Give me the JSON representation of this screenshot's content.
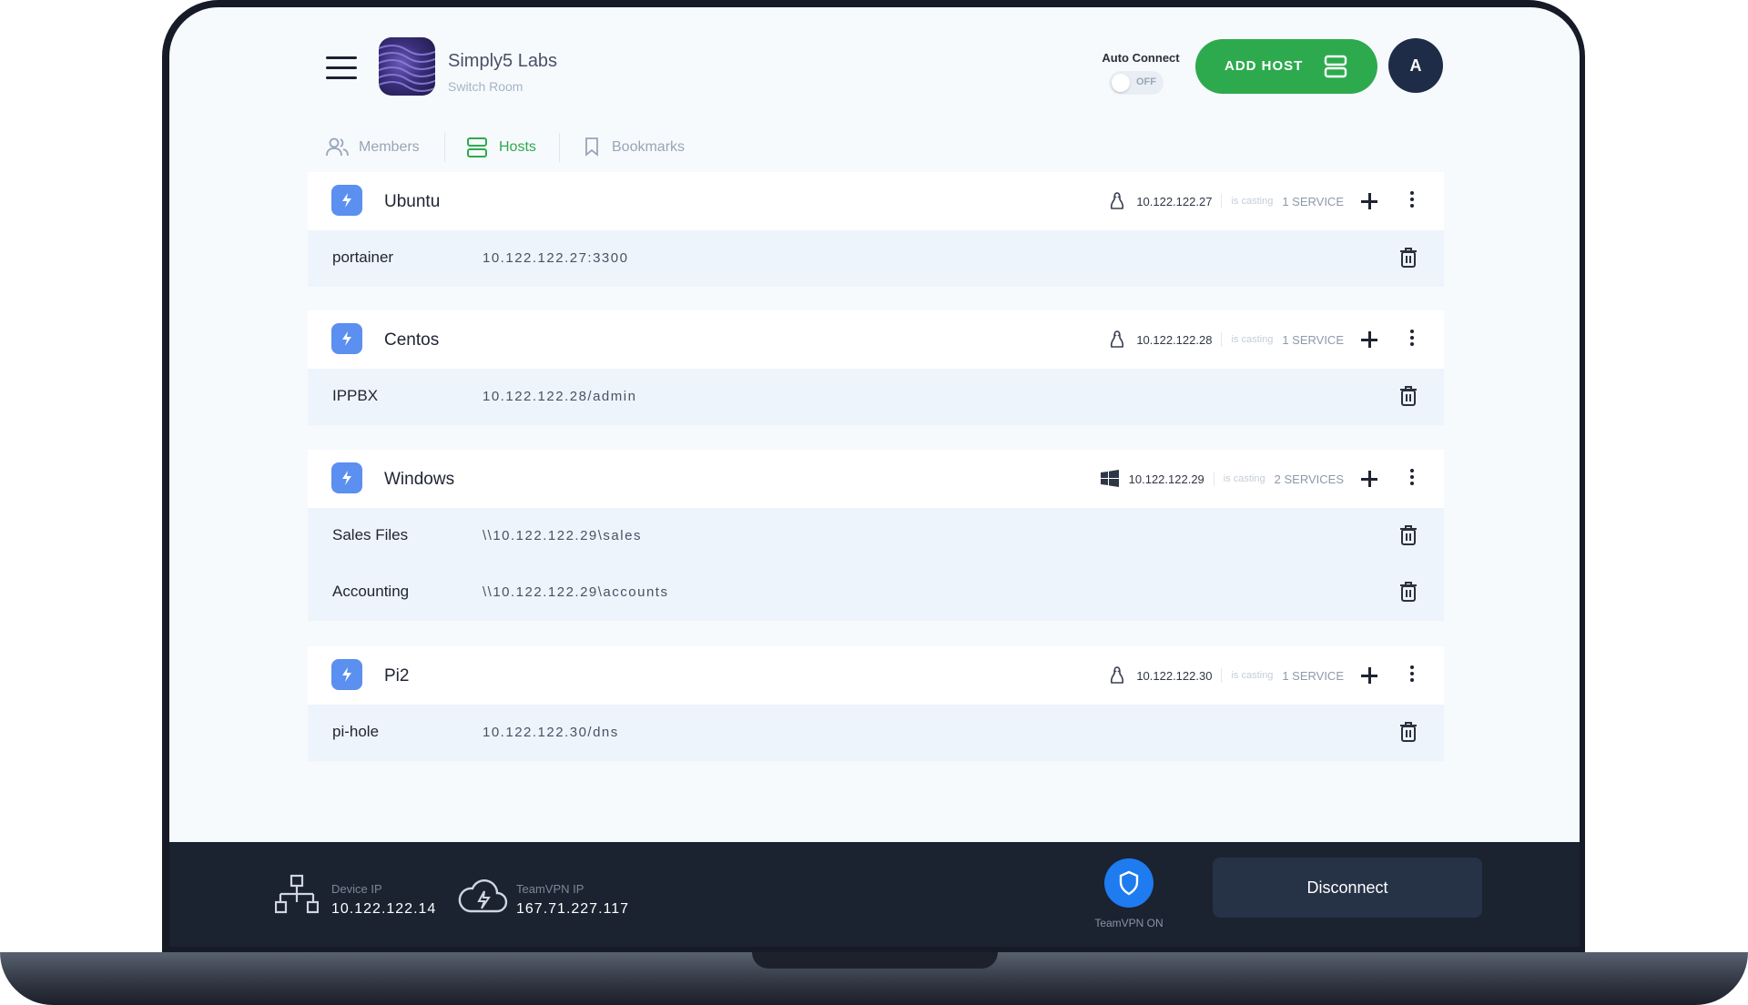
{
  "header": {
    "workspace_name": "Simply5 Labs",
    "workspace_subtitle": "Switch Room",
    "auto_connect_label": "Auto Connect",
    "auto_connect_state": "OFF",
    "add_host_label": "ADD HOST",
    "avatar_initial": "A"
  },
  "tabs": [
    {
      "label": "Members",
      "active": false
    },
    {
      "label": "Hosts",
      "active": true
    },
    {
      "label": "Bookmarks",
      "active": false
    }
  ],
  "hosts": [
    {
      "name": "Ubuntu",
      "os": "linux",
      "ip": "10.122.122.27",
      "casting": "is casting",
      "services_label": "1 SERVICE",
      "services": [
        {
          "name": "portainer",
          "address": "10.122.122.27:3300"
        }
      ]
    },
    {
      "name": "Centos",
      "os": "linux",
      "ip": "10.122.122.28",
      "casting": "is casting",
      "services_label": "1 SERVICE",
      "services": [
        {
          "name": "IPPBX",
          "address": "10.122.122.28/admin"
        }
      ]
    },
    {
      "name": "Windows",
      "os": "windows",
      "ip": "10.122.122.29",
      "casting": "is casting",
      "services_label": "2 SERVICES",
      "services": [
        {
          "name": "Sales Files",
          "address": "\\\\10.122.122.29\\sales"
        },
        {
          "name": "Accounting",
          "address": "\\\\10.122.122.29\\accounts"
        }
      ]
    },
    {
      "name": "Pi2",
      "os": "linux",
      "ip": "10.122.122.30",
      "casting": "is casting",
      "services_label": "1 SERVICE",
      "services": [
        {
          "name": "pi-hole",
          "address": "10.122.122.30/dns"
        }
      ]
    }
  ],
  "footer": {
    "device_ip_label": "Device IP",
    "device_ip": "10.122.122.14",
    "teamvpn_ip_label": "TeamVPN IP",
    "teamvpn_ip": "167.71.227.117",
    "vpn_status": "TeamVPN ON",
    "disconnect_label": "Disconnect"
  },
  "colors": {
    "accent_green": "#2eaa4e",
    "host_icon_blue": "#5b8ff0",
    "footer_bg": "#1b2230",
    "vpn_blue": "#1e7bf0"
  }
}
